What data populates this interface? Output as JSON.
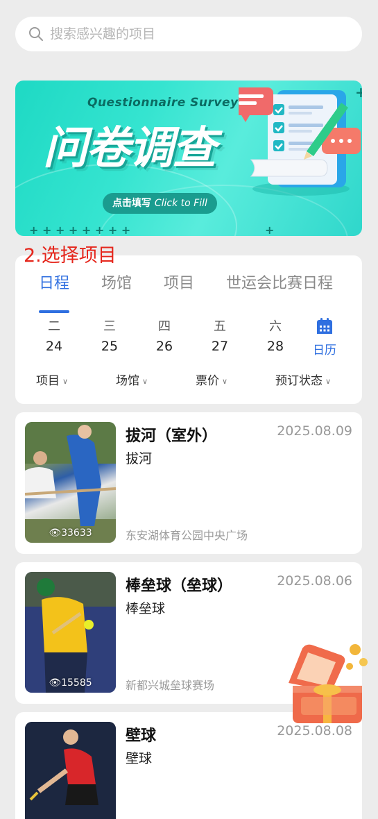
{
  "search": {
    "placeholder": "搜索感兴趣的项目"
  },
  "banner": {
    "subtitle": "Questionnaire Survey",
    "title": "问卷调查",
    "button_cn": "点击填写",
    "button_en": "Click to Fill"
  },
  "step_label": "2.选择项目",
  "tabs": [
    {
      "label": "日程",
      "active": true
    },
    {
      "label": "场馆",
      "active": false
    },
    {
      "label": "项目",
      "active": false
    },
    {
      "label": "世运会比赛日程",
      "active": false
    }
  ],
  "days": [
    {
      "weekday": "二",
      "date": "24"
    },
    {
      "weekday": "三",
      "date": "25"
    },
    {
      "weekday": "四",
      "date": "26"
    },
    {
      "weekday": "五",
      "date": "27"
    },
    {
      "weekday": "六",
      "date": "28"
    }
  ],
  "calendar": {
    "label": "日历",
    "icon": "calendar-icon"
  },
  "filters": [
    {
      "label": "项目"
    },
    {
      "label": "场馆"
    },
    {
      "label": "票价"
    },
    {
      "label": "预订状态"
    }
  ],
  "events": [
    {
      "title": "拔河（室外）",
      "subtitle": "拔河",
      "date": "2025.08.09",
      "venue": "东安湖体育公园中央广场",
      "views": "33633"
    },
    {
      "title": "棒垒球（垒球）",
      "subtitle": "棒垒球",
      "date": "2025.08.06",
      "venue": "新都兴城垒球赛场",
      "views": "15585"
    },
    {
      "title": "壁球",
      "subtitle": "壁球",
      "date": "2025.08.08",
      "venue": "",
      "views": ""
    }
  ],
  "colors": {
    "accent": "#2f6fe0",
    "step_label": "#e5261c",
    "banner": "#35e4d0"
  }
}
